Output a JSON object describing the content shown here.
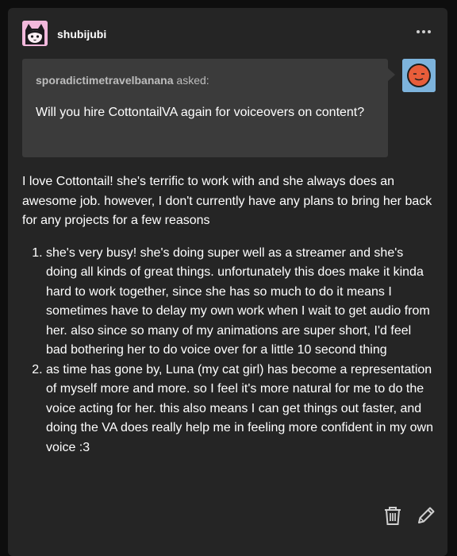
{
  "post": {
    "author": "shubijubi",
    "menu_icon": "ellipsis-icon"
  },
  "ask": {
    "asker": "sporadictimetravelbanana",
    "asked_suffix": " asked:",
    "question": "Will you hire CottontailVA again for voiceovers on content?",
    "asker_avatar_color": "#7db3dc",
    "asker_avatar_face": "#e85d3a"
  },
  "answer": {
    "intro": "I love Cottontail! she's terrific to work with and she always does an awesome job. however, I don't currently have any plans to bring her back for any projects for a few reasons",
    "reasons": [
      "she's very busy! she's doing super well as a streamer and she's doing all kinds of great things. unfortunately this does make it kinda hard to work together, since she has so much to do it means I sometimes have to delay my own work when I wait to get audio from her. also since so many of my animations are super short, I'd feel bad bothering her to do voice over for a little 10 second thing",
      "as time has gone by, Luna (my cat girl) has become a representation of myself more and more. so I feel it's more natural for me to do the voice acting for her. this also means I can get things out faster, and doing the VA does really help me in feeling more confident in my own voice :3"
    ]
  },
  "actions": {
    "delete_icon": "trash-icon",
    "edit_icon": "pencil-icon"
  },
  "colors": {
    "background": "#0e0e0e",
    "card": "#252525",
    "ask_box": "#3b3b3b",
    "author_avatar": "#f2b8dc"
  }
}
